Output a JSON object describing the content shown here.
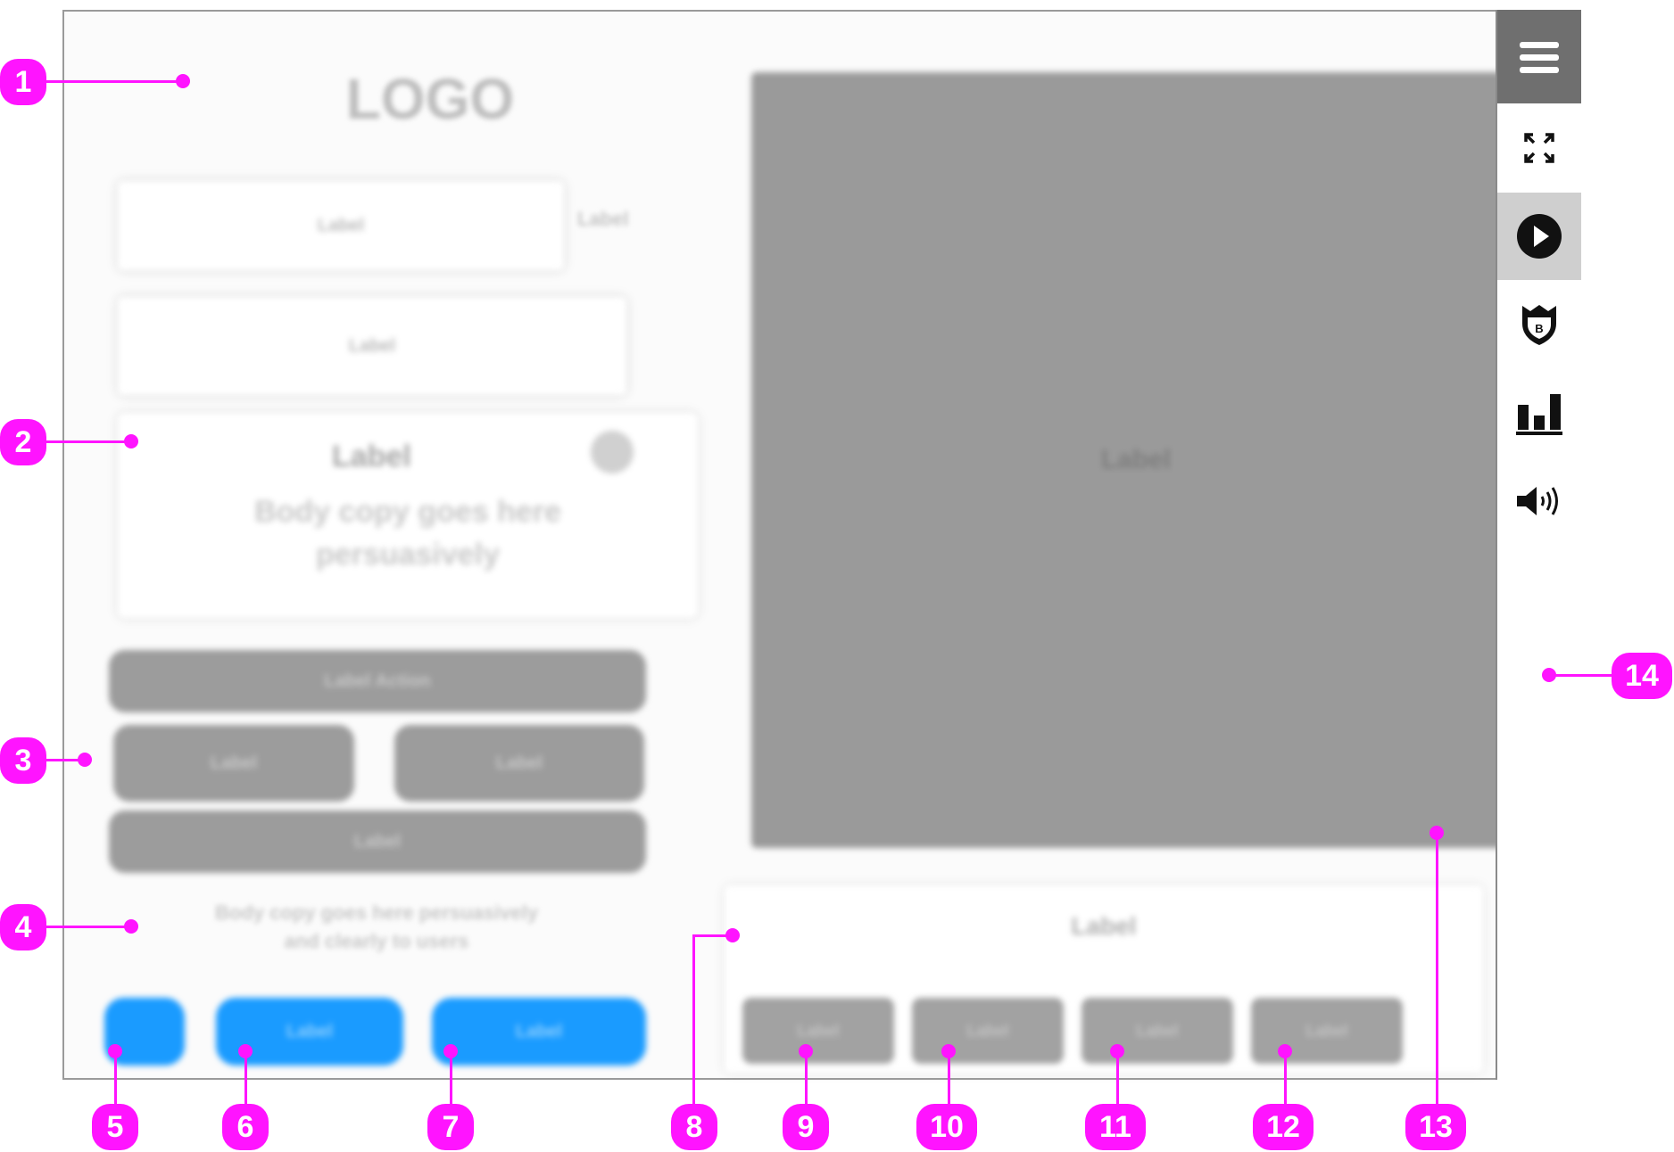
{
  "left_panel": {
    "logo": "LOGO",
    "field_1": "Label",
    "field_2": "Label",
    "side_label": "Label",
    "info_title": "Label",
    "info_text_line1": "Body copy goes here",
    "info_text_line2": "persuasively",
    "wide_button": "Label Action",
    "half_button_left": "Label",
    "half_button_right": "Label",
    "bottom_button": "Label",
    "footnote_line1": "Body copy goes here persuasively",
    "footnote_line2": "and clearly to users",
    "small_blue_button": "",
    "blue_button_1": "Label",
    "blue_button_2": "Label"
  },
  "main": {
    "media_label": "Label",
    "caption_label": "Label",
    "tool_buttons": [
      "Label",
      "Label",
      "Label",
      "Label"
    ]
  },
  "sidebar": {
    "icons": [
      "menu-icon",
      "fullscreen-icon",
      "play-icon",
      "shield-b-icon",
      "bar-chart-icon",
      "volume-icon"
    ]
  },
  "callouts": [
    "1",
    "2",
    "3",
    "4",
    "5",
    "6",
    "7",
    "8",
    "9",
    "10",
    "11",
    "12",
    "13",
    "14"
  ],
  "colors": {
    "callout": "#ff14ff",
    "blue_button": "#1a9bff",
    "media_grey": "#9a9a9a",
    "sidebar_header": "#6f6f6f"
  }
}
